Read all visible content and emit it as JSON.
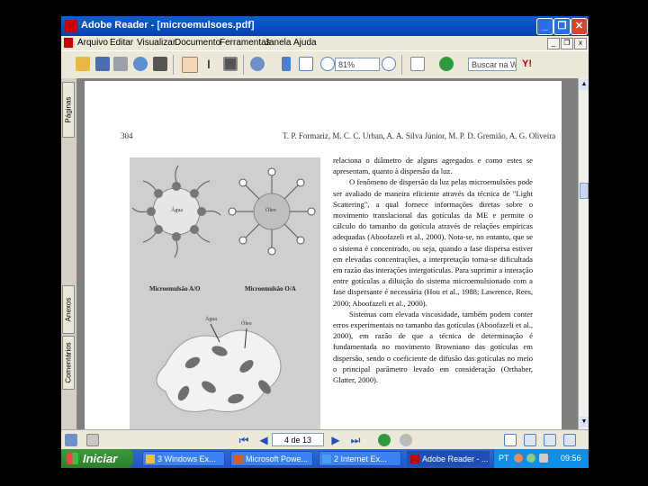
{
  "window": {
    "title": "Adobe Reader - [microemulsoes.pdf]",
    "controls": {
      "minimize": "_",
      "restore": "❐",
      "close": "✕"
    }
  },
  "menu": {
    "items": [
      "Arquivo",
      "Editar",
      "Visualizar",
      "Documento",
      "Ferramentas",
      "Janela",
      "Ajuda"
    ],
    "mdi_controls": {
      "minimize": "_",
      "restore": "❐",
      "close": "x"
    }
  },
  "toolbar": {
    "zoom_value": "81%",
    "search_placeholder": "Buscar na Web"
  },
  "nav_tabs": [
    "Páginas",
    "Anexos",
    "Comentários"
  ],
  "document": {
    "page_number": "304",
    "running_header": "T. P. Formariz, M. C. C. Urban, A. A. Silva Júnior, M. P. D. Gremião, A. G. Oliveira",
    "figure_labels": {
      "left_caption": "Microemulsão A/O",
      "right_caption": "Microemulsão O/A",
      "left_inner": "Água",
      "right_inner": "Óleo",
      "lower_label_1": "Água",
      "lower_label_2": "Óleo"
    },
    "paragraphs": [
      "relaciona o diâmetro de alguns agregados e como estes se apresentam, quanto à dispersão da luz.",
      "O fenômeno de dispersão da luz pelas microemulsões pode ser avaliado de maneira eficiente através da técnica de \"Light Scattering\", a qual fornece informações diretas sobre o movimento translacional das gotículas da ME e permite o cálculo do tamanho da gotícula através de relações empíricas adequadas (Aboofazeli et al., 2000). Nota-se, no entanto, que se o sistema é concentrado, ou seja, quando a fase dispersa estiver em elevadas concentrações, a interpretação torna-se dificultada em razão das interações intergotículas. Para suprimir a interação entre gotículas a diluição do sistema microemulsionado com a fase dispersante é necessária (Hou et al., 1988; Lawrence, Rees, 2000; Aboofazeli et al., 2000).",
      "Sistemas com elevada viscosidade, também podem conter erros experimentais no tamanho das gotículas (Aboofazeli et al., 2000), em razão de que a técnica de determinação é fundamentada no movimento Browniano das gotículas em dispersão, sendo o coeficiente de difusão das gotículas no meio o principal parâmetro levado em consideração (Orthaber, Glatter, 2000)."
    ]
  },
  "statusbar": {
    "page_indicator": "4 de 13"
  },
  "taskbar": {
    "start_label": "Iniciar",
    "tasks": [
      "3 Windows Ex...",
      "Microsoft Powe...",
      "2 Internet Ex...",
      "Adobe Reader - ..."
    ],
    "language": "PT",
    "clock": "09:56"
  },
  "colors": {
    "title_bar": "#0840b0",
    "taskbar": "#2454c4",
    "start_button": "#2c7f2c",
    "chrome": "#ece9d8",
    "document_background": "#7f7f7f"
  }
}
